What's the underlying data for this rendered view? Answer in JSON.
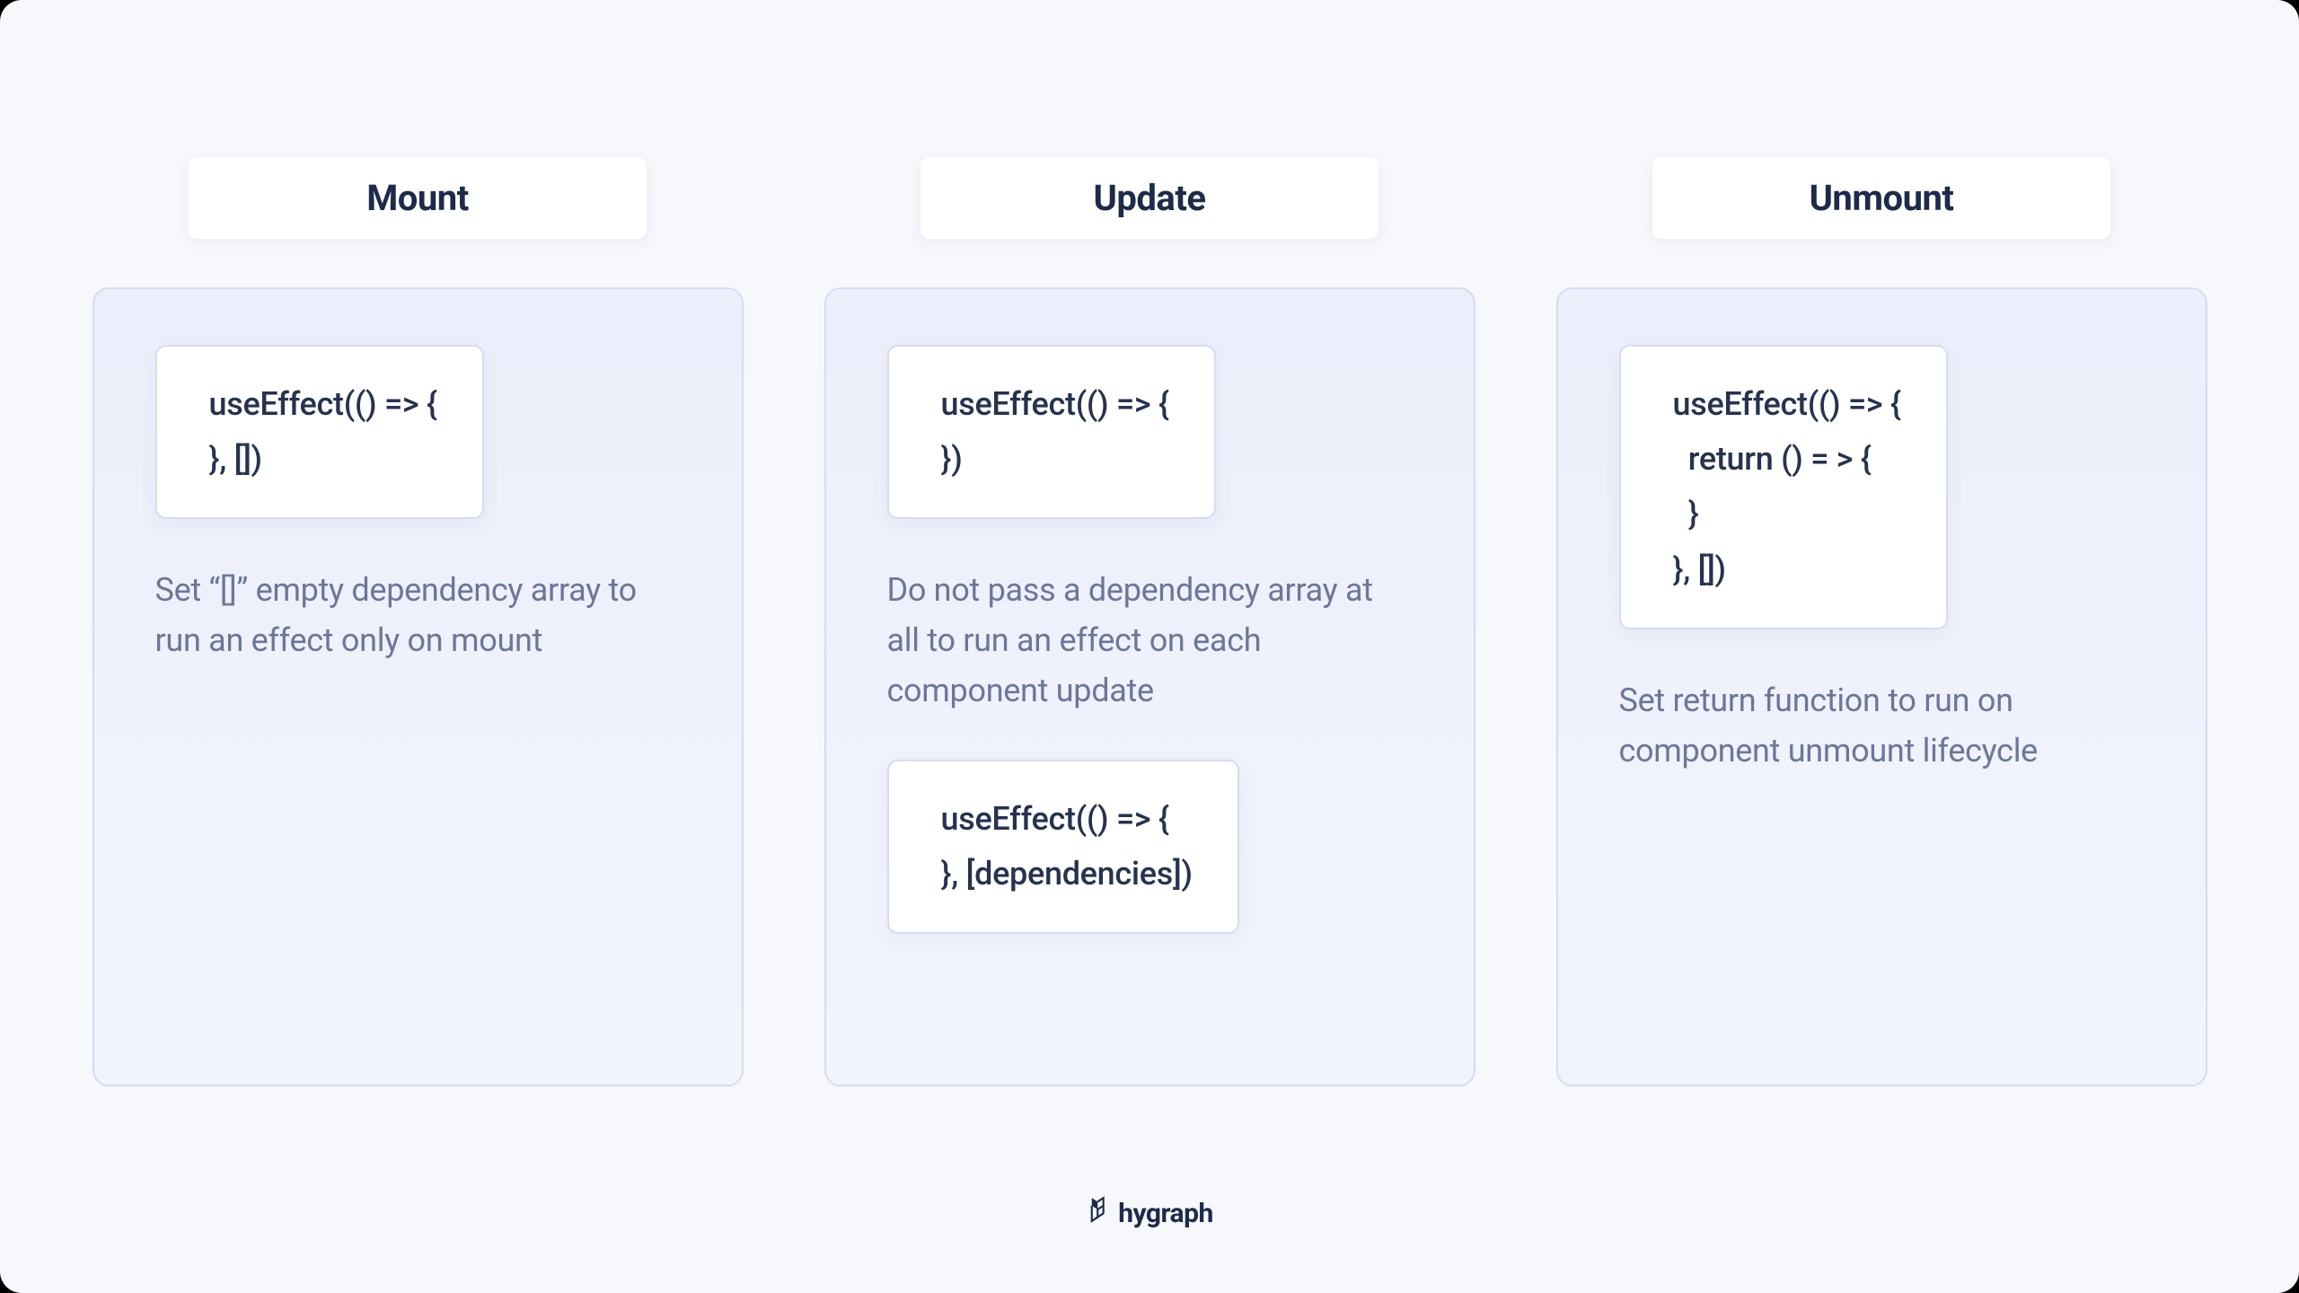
{
  "columns": [
    {
      "title": "Mount",
      "code1": {
        "line1": "useEffect(() => {",
        "line2": "}, [])"
      },
      "desc1": "Set “[]” empty dependency array to run an effect only on mount"
    },
    {
      "title": "Update",
      "code1": {
        "line1": "useEffect(() => {",
        "line2": "})"
      },
      "desc1": "Do not pass a dependency array at all to run an effect on each component update",
      "code2": {
        "line1": "useEffect(() => {",
        "line2": "}, [dependencies])"
      }
    },
    {
      "title": "Unmount",
      "code1": {
        "line1": "useEffect(() => {",
        "line2": "  return () = > {",
        "line3": "  }",
        "line4": "}, [])"
      },
      "desc1": "Set return function to run on component unmount lifecycle"
    }
  ],
  "brand": "hygraph"
}
